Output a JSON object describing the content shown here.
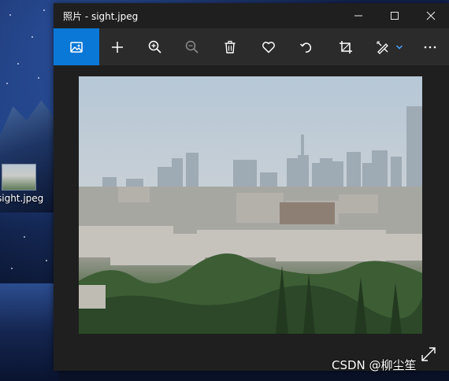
{
  "window": {
    "title": "照片 - sight.jpeg"
  },
  "desktop": {
    "icon_label": "sight.jpeg"
  },
  "toolbar": {
    "items": [
      {
        "icon": "image-view-icon"
      },
      {
        "icon": "add-icon"
      },
      {
        "icon": "zoom-in-icon"
      },
      {
        "icon": "zoom-out-icon"
      },
      {
        "icon": "delete-icon"
      },
      {
        "icon": "heart-icon"
      },
      {
        "icon": "rotate-icon"
      },
      {
        "icon": "crop-icon"
      },
      {
        "icon": "edit-icon"
      },
      {
        "icon": "more-icon"
      }
    ]
  },
  "watermark": "CSDN @柳尘笙",
  "colors": {
    "accent": "#0a78d7",
    "window_bg": "#1f1f1f",
    "toolbar_bg": "#2b2b2b"
  }
}
